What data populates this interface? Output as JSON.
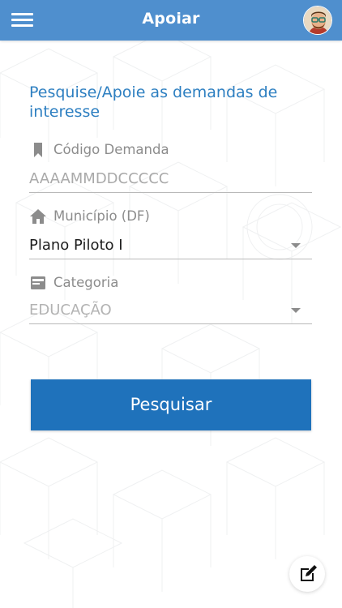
{
  "header": {
    "title": "Apoiar",
    "menu_icon": "hamburger-menu-icon",
    "avatar_icon": "user-avatar"
  },
  "form": {
    "heading": "Pesquise/Apoie as demandas de interesse",
    "codigo": {
      "label": "Código Demanda",
      "icon": "bookmark-icon",
      "placeholder": "AAAAMMDDCCCCC"
    },
    "municipio": {
      "label": "Município (DF)",
      "icon": "home-icon",
      "selected": "Plano Piloto I"
    },
    "categoria": {
      "label": "Categoria",
      "icon": "card-icon",
      "selected": "EDUCAÇÃO"
    },
    "search_button": "Pesquisar"
  },
  "fab": {
    "icon": "edit-icon"
  },
  "colors": {
    "topbar": "#4f8fce",
    "heading": "#2d7fc1",
    "button": "#1f72bb"
  }
}
